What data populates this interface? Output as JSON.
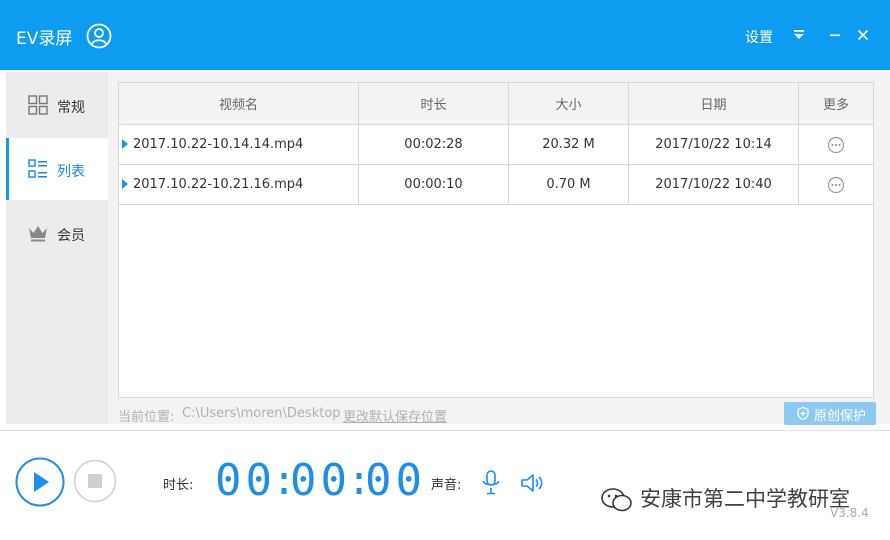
{
  "app": {
    "title": "EV录屏",
    "version": "V3.8.4"
  },
  "titlebar": {
    "settings_label": "设置"
  },
  "sidebar": {
    "items": [
      {
        "label": "常规",
        "icon": "grid-icon",
        "active": false
      },
      {
        "label": "列表",
        "icon": "list-icon",
        "active": true
      },
      {
        "label": "会员",
        "icon": "crown-icon",
        "active": false
      }
    ]
  },
  "table": {
    "columns": [
      "视频名",
      "时长",
      "大小",
      "日期",
      "更多"
    ],
    "rows": [
      {
        "name": "2017.10.22-10.14.14.mp4",
        "duration": "00:02:28",
        "size": "20.32 M",
        "date": "2017/10/22 10:14"
      },
      {
        "name": "2017.10.22-10.21.16.mp4",
        "duration": "00:00:10",
        "size": "0.70 M",
        "date": "2017/10/22 10:40"
      }
    ]
  },
  "location": {
    "label": "当前位置:",
    "path": "C:\\Users\\moren\\Desktop",
    "change_link": "更改默认保存位置",
    "protect_button": "原创保护"
  },
  "controls": {
    "duration_label": "时长:",
    "timer": {
      "hours": "00",
      "minutes": "00",
      "seconds": "00"
    },
    "sound_label": "声音:"
  },
  "watermark": {
    "text": "安康市第二中学教研室"
  },
  "colors": {
    "accent": "#0e9cf0",
    "digits": "#1e8ee6"
  }
}
